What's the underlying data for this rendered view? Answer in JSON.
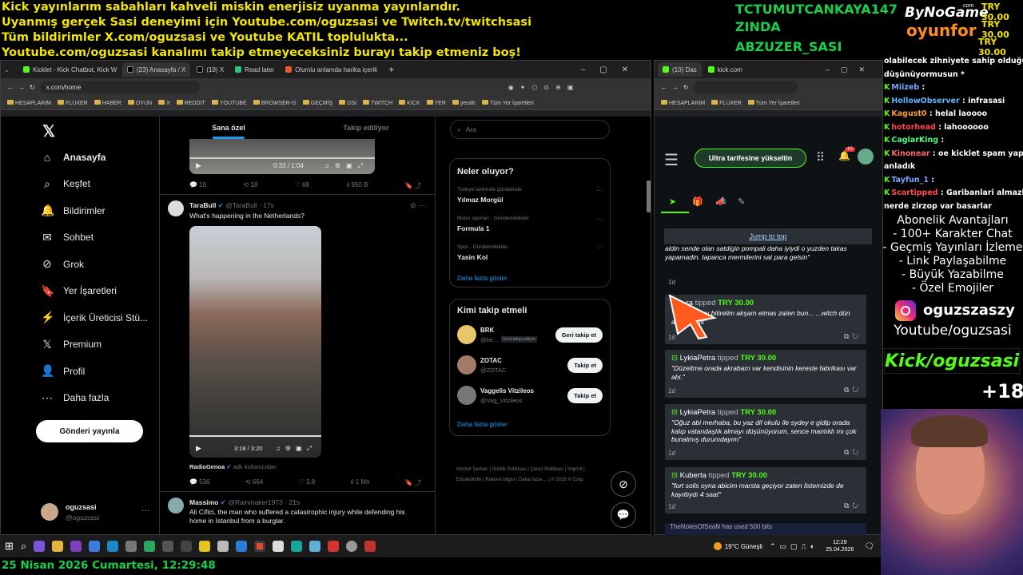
{
  "banner": {
    "line1": "Kick yayınlarım sabahları kahveli miskin enerjisiz uyanma yayınlarıdır.",
    "line2": "Uyanmış gerçek Sasi deneyimi için Youtube.com/oguzsasi ve Twitch.tv/twitchsasi",
    "line3": "Tüm bildirimler X.com/oguzsasi ve Youtube KATIL topluluktа...",
    "line4": "Youtube.com/oguzsasi kanalımı takip etmeyeceksiniz burayı takip etmeniz boş!"
  },
  "names": [
    "TCTUMUTCANKAYA147",
    "ZINDA",
    "ABZUZER_SASI"
  ],
  "logo": {
    "top": "ByNoGame",
    "com": ".com",
    "bottom": "oyunfor"
  },
  "try": [
    "TRY 30.00",
    "TRY 30.00",
    "TRY 30.00"
  ],
  "browser1": {
    "tabs": [
      "Kicklet - Kick Chatbot, Kick W",
      "(23) Anasayfa / X",
      "(19) X",
      "Read later",
      "Olumlu anlamda harika içerik"
    ],
    "url": "x.com/home",
    "bookmarks": [
      "HESAPLARIM",
      "FLUXER",
      "HABER",
      "OYUN",
      "X",
      "REDDIT",
      "YOUTUBE",
      "BROWSER-G",
      "GEÇMİŞ",
      "DSİ",
      "TWITCH",
      "KICK",
      "YER",
      "yeraltı",
      "Tüm Yer İşaretleri"
    ]
  },
  "x": {
    "nav": [
      "Anasayfa",
      "Keşfet",
      "Bildirimler",
      "Sohbet",
      "Grok",
      "Yer İşaretleri",
      "İçerik Üreticisi Stü...",
      "Premium",
      "Profil",
      "Daha fazla"
    ],
    "post_button": "Gönderi yayınla",
    "user_name": "oguzsasi",
    "user_handle": "@oguzsasi",
    "tabs": [
      "Sana özel",
      "Takip ediliyor"
    ],
    "video1_time": "0:33 / 1:04",
    "t1_stats": [
      "18",
      "18",
      "68",
      "950 B"
    ],
    "t2": {
      "name": "TaraBull",
      "handle": "@TaraBull · 17s",
      "text": "What's happening in the Netherlands?",
      "video_time": "3:18 / 3:20",
      "quote": "RadioGenoa",
      "quote_sub": "adlı kullanıcıdan",
      "stats": [
        "536",
        "664",
        "3.8",
        "1 Mn"
      ]
    },
    "t3": {
      "name": "Massimo",
      "handle": "@Rainmaker1973 · 21s",
      "text": "Ali Ciftci, the man who suffered a catastrophic injury while defending his home in Istanbul from a burglar."
    },
    "search_placeholder": "Ara",
    "trends_title": "Neler oluyor?",
    "trends": [
      {
        "cat": "Türkiye tarihinde gündemde",
        "name": "Yılmaz Morgül"
      },
      {
        "cat": "Motor sporları · Gündemdekiler",
        "name": "Formula 1"
      },
      {
        "cat": "Spor · Gündemdekiler",
        "name": "Yasin Kol"
      }
    ],
    "show_more": "Daha fazla göster",
    "follow_title": "Kimi takip etmeli",
    "follow": [
      {
        "name": "BRK",
        "handle": "@be...",
        "badge": "Seni takip ediyor",
        "btn": "Geri takip et"
      },
      {
        "name": "ZOTAC",
        "handle": "@ZOTAC",
        "btn": "Takip et"
      },
      {
        "name": "Vaggelis Vitzileos",
        "handle": "@Vag_Vitzileos",
        "btn": "Takip et"
      }
    ],
    "show_more2": "Daha fazla göster",
    "footer": [
      "Hizmet Şartları",
      "Gizlilik Politikası",
      "Çerez Politikası",
      "Imprint",
      "Erişilebilirlik",
      "Reklam bilgisi",
      "Daha fazla ...",
      "© 2026 X Corp."
    ]
  },
  "browser2": {
    "tabs": [
      "(10) Das",
      "kick.com"
    ],
    "bookmarks": [
      "HESAPLARIM",
      "FLUXER",
      "Tüm Yer İşaretleri"
    ],
    "upgrade": "Ultra tarifesine yükseltin",
    "notif_count": "10",
    "jump": "Jump to top",
    "first_msg": "aldin sende olan satdigin pompali daha iyiydi o yuzden takas yapamadin. tapanca mermilerini sat para gelsin\"",
    "tips": [
      {
        "who": "...ra",
        "amount": "TRY 30.00",
        "msg": "\"a... ...elroyu bitirelim akşam elmas zaten bun... ...witch dün altın yaptık\"",
        "age": "1d"
      },
      {
        "who": "LykiaPetra",
        "amount": "TRY 30.00",
        "msg": "\"Düzeltme orada akrabam var kendisinin kereste fabrikası var abi.\"",
        "age": "1d"
      },
      {
        "who": "LykiaPetra",
        "amount": "TRY 30.00",
        "msg": "\"Oğuz abi merhaba, bu yaz dil okulu ile sydey e gidip orada kalıp vatandaşlık almayı düşünüyorum, sence mantıklı mı çok bunalmış durumdayım\"",
        "age": "1d"
      },
      {
        "who": "Kuberta",
        "amount": "TRY 30.00",
        "msg": "\"fort solis oyna abicim marsta geçiyor zaten listemizde de kayıtlıydı 4 saat\"",
        "age": "1d"
      }
    ],
    "tipped": "tipped",
    "first_age": "1d",
    "last_line": "TheNotesOfSeaN has used 500 bits"
  },
  "chat": [
    {
      "user": "",
      "text": "olabilecek zihniyete sahip olduğunu"
    },
    {
      "user": "",
      "text": "düşünüyormusun *"
    },
    {
      "user": "Miizeb",
      "text": " : ",
      "color": "#7aa7ff"
    },
    {
      "user": "HollowObserver",
      "text": " : infrasasi",
      "color": "#5cb8ff"
    },
    {
      "user": "Kagust0",
      "text": " : helal laoooo",
      "color": "#ff9d3b"
    },
    {
      "user": "hotorhead",
      "text": " : lahoooooo",
      "color": "#ff4b4b"
    },
    {
      "user": "CaglarKing",
      "text": " : ",
      "color": "#4bff7a"
    },
    {
      "user": "Kinonear",
      "text": " : oe kicklet spam yapiyo ne",
      "color": "#ff6b6b"
    },
    {
      "user": "",
      "text": "anladık"
    },
    {
      "user": "Tayfun_1",
      "text": " : ",
      "color": "#7aa7ff"
    },
    {
      "user": "Scartipped",
      "text": " : Garibanlari almazlar",
      "color": "#ff4b4b"
    },
    {
      "user": "",
      "text": "nerde zirzop var basarlar"
    }
  ],
  "promo": {
    "title": "Abonelik Avantajları",
    "items": [
      "- 100+ Karakter Chat",
      "- Geçmiş Yayınları İzleme",
      "- Link Paylaşabilme",
      "- Büyük Yazabilme",
      "- Özel Emojiler"
    ],
    "insta": "oguzszaszy",
    "yt": "Youtube/oguzsasi",
    "kick": "Kick/oguzsasi",
    "age": "+18"
  },
  "taskbar": {
    "weather": "19°C  Güneşli",
    "time": "12:29",
    "date": "25.04.2026"
  },
  "clock": "25 Nisan 2026 Cumartesi, 12:29:48"
}
